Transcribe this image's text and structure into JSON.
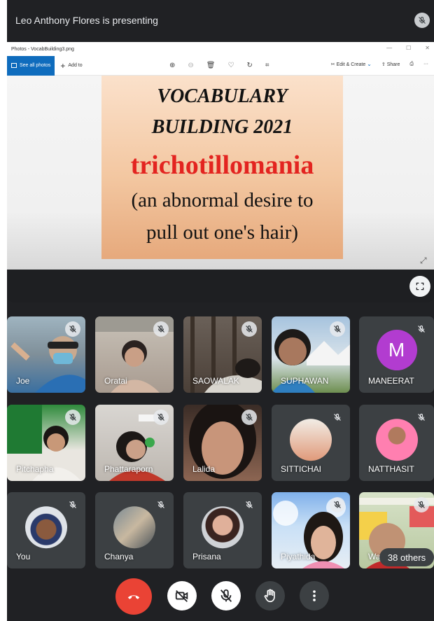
{
  "topbar": {
    "presenter_text": "Leo Anthony Flores is presenting"
  },
  "photos_window": {
    "title": "Photos - VocabBuilding3.png",
    "see_all_label": "See all photos",
    "add_to_label": "Add to",
    "edit_create_label": "Edit & Create",
    "share_label": "Share"
  },
  "slide": {
    "line1": "VOCABULARY",
    "line2": "BUILDING 2021",
    "word": "trichotillomania",
    "definition_line1": "(an abnormal desire to",
    "definition_line2": "pull out one's hair)"
  },
  "participants": [
    {
      "name": "Joe"
    },
    {
      "name": "Oratai"
    },
    {
      "name": "SAOWALAK"
    },
    {
      "name": "SUPHAWAN"
    },
    {
      "name": "MANEERAT",
      "initial": "M"
    },
    {
      "name": "Pitchapha"
    },
    {
      "name": "Phattaraporn"
    },
    {
      "name": "Lalida"
    },
    {
      "name": "SITTICHAI"
    },
    {
      "name": "NATTHASIT"
    },
    {
      "name": "You"
    },
    {
      "name": "Chanya"
    },
    {
      "name": "Prisana"
    },
    {
      "name": "Piyathida"
    },
    {
      "name": "Wa"
    }
  ],
  "others_chip": "38 others",
  "colors": {
    "background": "#202124",
    "tile": "#3c4043",
    "end_call": "#ea4335",
    "slide_word": "#e32420",
    "avatar_m": "#b23cd0"
  }
}
